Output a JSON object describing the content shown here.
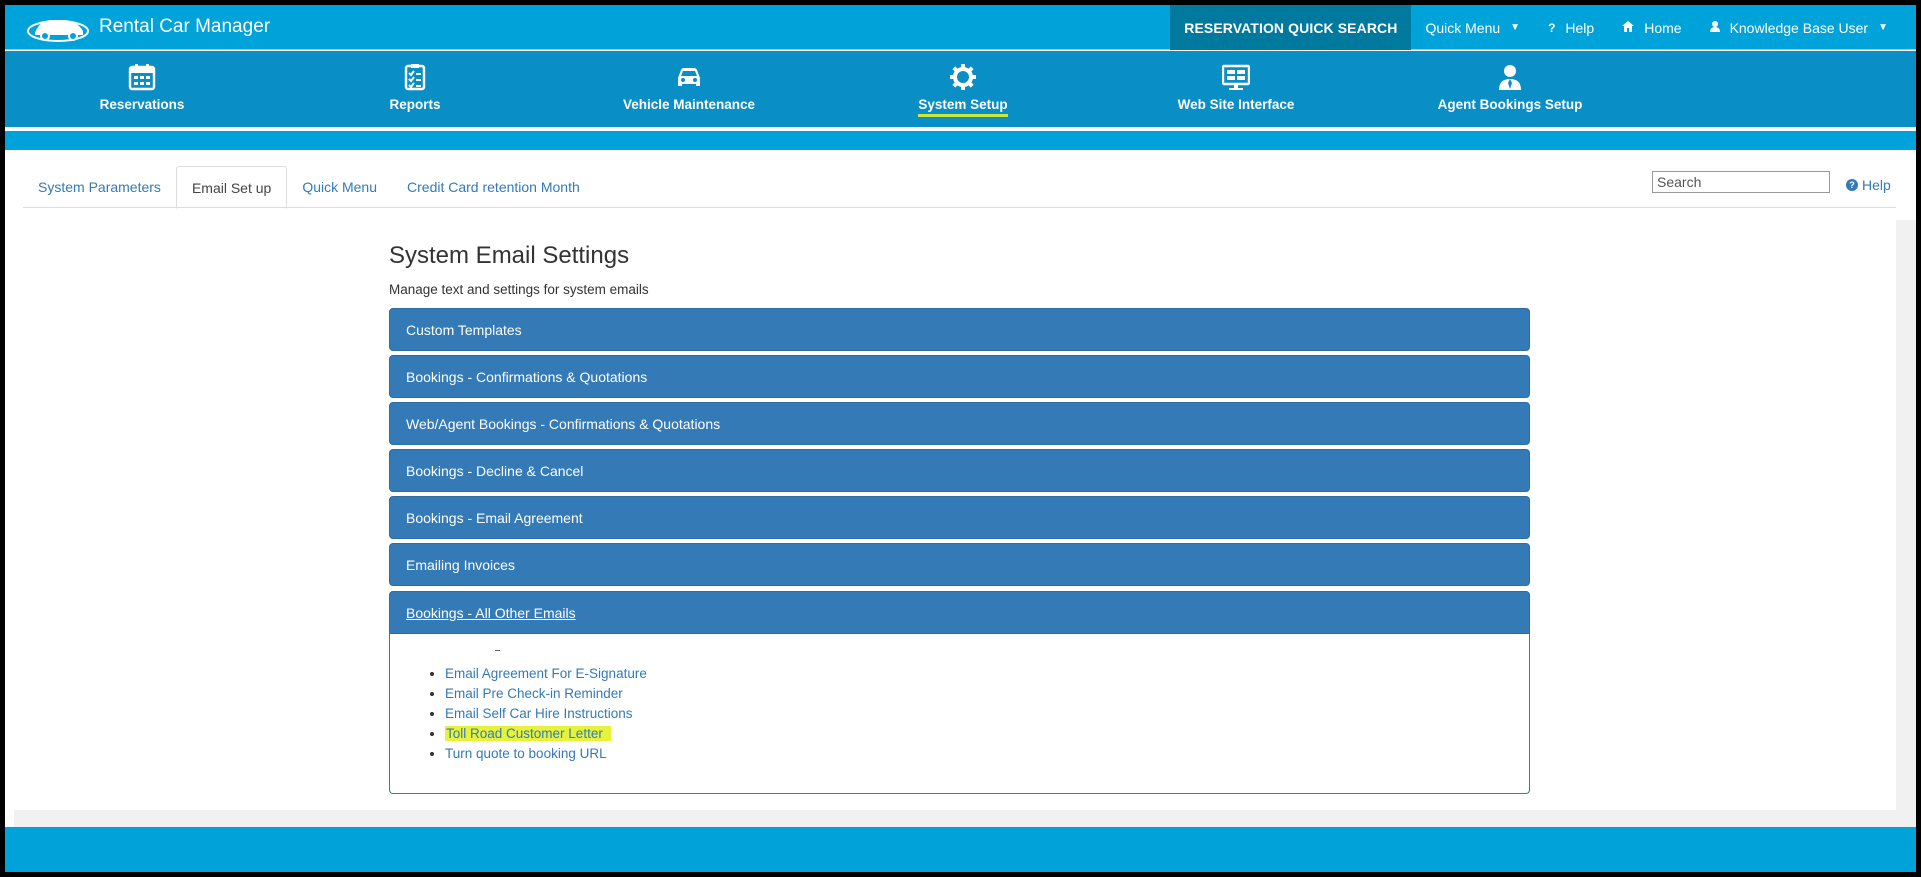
{
  "app": {
    "title": "Rental Car Manager"
  },
  "topnav": {
    "quick_search": "RESERVATION QUICK SEARCH",
    "quick_menu": "Quick Menu",
    "help": "Help",
    "home": "Home",
    "user": "Knowledge Base User"
  },
  "mainnav": {
    "items": [
      {
        "label": "Reservations",
        "icon": "calendar-icon"
      },
      {
        "label": "Reports",
        "icon": "clipboard-icon"
      },
      {
        "label": "Vehicle Maintenance",
        "icon": "car-icon"
      },
      {
        "label": "System Setup",
        "icon": "gear-icon",
        "active": true
      },
      {
        "label": "Web Site Interface",
        "icon": "monitor-icon"
      },
      {
        "label": "Agent Bookings Setup",
        "icon": "agent-icon"
      }
    ]
  },
  "tabs": [
    {
      "label": "System Parameters"
    },
    {
      "label": "Email Set up",
      "active": true
    },
    {
      "label": "Quick Menu"
    },
    {
      "label": "Credit Card retention Month"
    }
  ],
  "search": {
    "placeholder": "Search"
  },
  "help_link": "Help",
  "page": {
    "title": "System Email Settings",
    "subtitle": "Manage text and settings for system emails"
  },
  "panels": [
    {
      "label": "Custom Templates"
    },
    {
      "label": "Bookings - Confirmations & Quotations"
    },
    {
      "label": "Web/Agent Bookings - Confirmations & Quotations"
    },
    {
      "label": "Bookings - Decline & Cancel"
    },
    {
      "label": "Bookings - Email Agreement"
    },
    {
      "label": "Emailing Invoices"
    },
    {
      "label": "Bookings - All Other Emails",
      "expanded": true
    }
  ],
  "email_links": [
    {
      "label": "Email Agreement For E-Signature"
    },
    {
      "label": "Email Pre Check-in Reminder"
    },
    {
      "label": "Email Self Car Hire Instructions"
    },
    {
      "label": "Toll Road Customer Letter",
      "highlighted": true
    },
    {
      "label": "Turn quote to booking URL"
    }
  ],
  "colors": {
    "topbar": "#00a3d9",
    "mainnav": "#0a8ec6",
    "panel": "#337ab7",
    "link": "#337ab7",
    "highlight": "#e7f23a",
    "active_underline": "#c9e83a"
  }
}
